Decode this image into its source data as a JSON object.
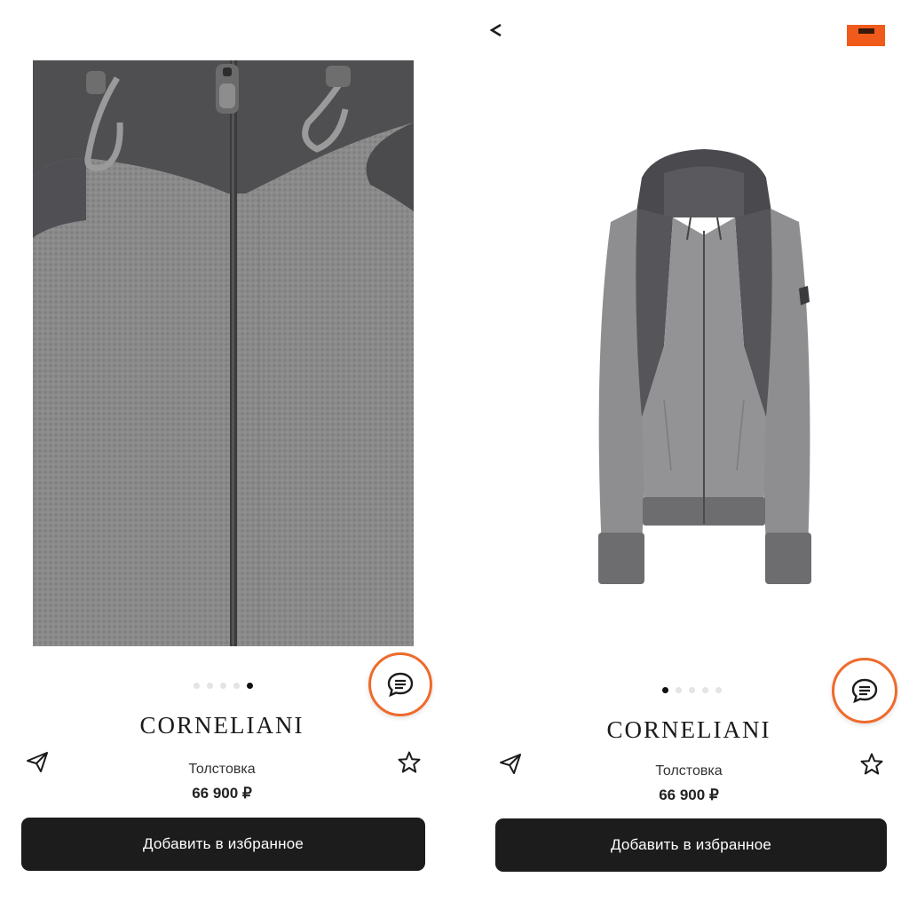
{
  "left_screen": {
    "product_image": "jacket-closeup-photo",
    "carousel": {
      "total": 5,
      "active_index": 4
    },
    "brand": "CORNELIANI",
    "product_type": "Толстовка",
    "price": "66 900 ₽",
    "favorite_button_label": "Добавить в избранное",
    "icons": {
      "chat": "chat-icon",
      "share": "paper-plane-icon",
      "favorite": "star-icon"
    }
  },
  "right_screen": {
    "product_image": "jacket-full-photo",
    "carousel": {
      "total": 5,
      "active_index": 0
    },
    "brand": "CORNELIANI",
    "product_type": "Толстовка",
    "price": "66 900 ₽",
    "favorite_button_label": "Добавить в избранное",
    "icons": {
      "back": "back-arrow-icon",
      "chat": "chat-icon",
      "share": "paper-plane-icon",
      "favorite": "star-icon"
    }
  },
  "colors": {
    "accent": "#ef6a2b",
    "button_bg": "#1c1c1c",
    "badge": "#f05a1a"
  }
}
